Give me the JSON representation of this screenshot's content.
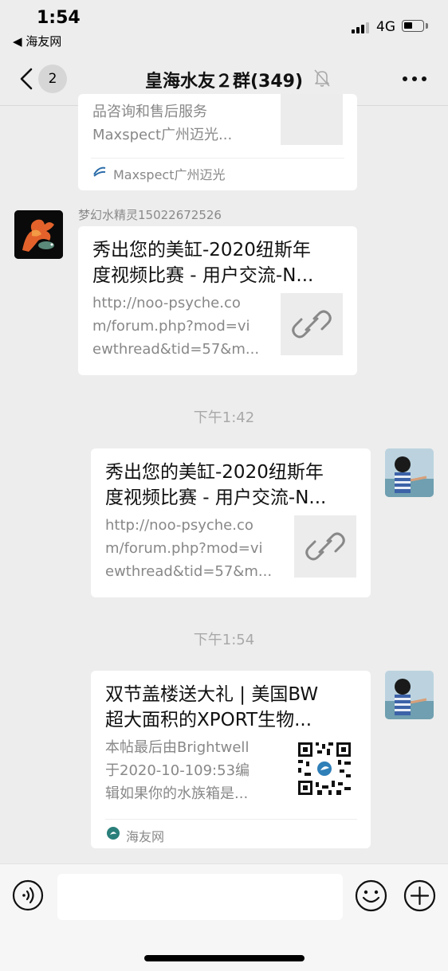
{
  "status_bar": {
    "time": "1:54",
    "back_app": "◀ 海友网",
    "network": "4G"
  },
  "nav": {
    "unread_count": "2",
    "title": "皇海水友２群(349)",
    "muted": true
  },
  "messages": [
    {
      "desc_line1": "品咨询和售后服务",
      "desc_line2": "Maxspect广州迈光...",
      "source": "Maxspect广州迈光"
    },
    {
      "sender": "梦幻水精灵15022672526",
      "title_line1": "秀出您的美缸-2020纽斯年",
      "title_line2": "度视频比赛 - 用户交流-N...",
      "desc_line1": "http://noo-psyche.co",
      "desc_line2": "m/forum.php?mod=vi",
      "desc_line3": "ewthread&tid=57&m..."
    },
    {
      "timestamp": "下午1:42",
      "title_line1": "秀出您的美缸-2020纽斯年",
      "title_line2": "度视频比赛 - 用户交流-N...",
      "desc_line1": "http://noo-psyche.co",
      "desc_line2": "m/forum.php?mod=vi",
      "desc_line3": "ewthread&tid=57&m..."
    },
    {
      "timestamp": "下午1:54",
      "title_line1": "双节盖楼送大礼 | 美国BW",
      "title_line2": "超大面积的XPORT生物...",
      "desc_line1": "本帖最后由Brightwell",
      "desc_line2": "于2020-10-109:53编",
      "desc_line3": "辑如果你的水族箱是...",
      "source": "海友网"
    }
  ],
  "icons": {
    "link": "link-icon",
    "qr": "qr-code-icon",
    "voice": "voice-icon",
    "emoji": "emoji-icon",
    "plus": "plus-icon"
  },
  "colors": {
    "background": "#ededed",
    "card": "#ffffff",
    "muted_text": "#888888"
  }
}
